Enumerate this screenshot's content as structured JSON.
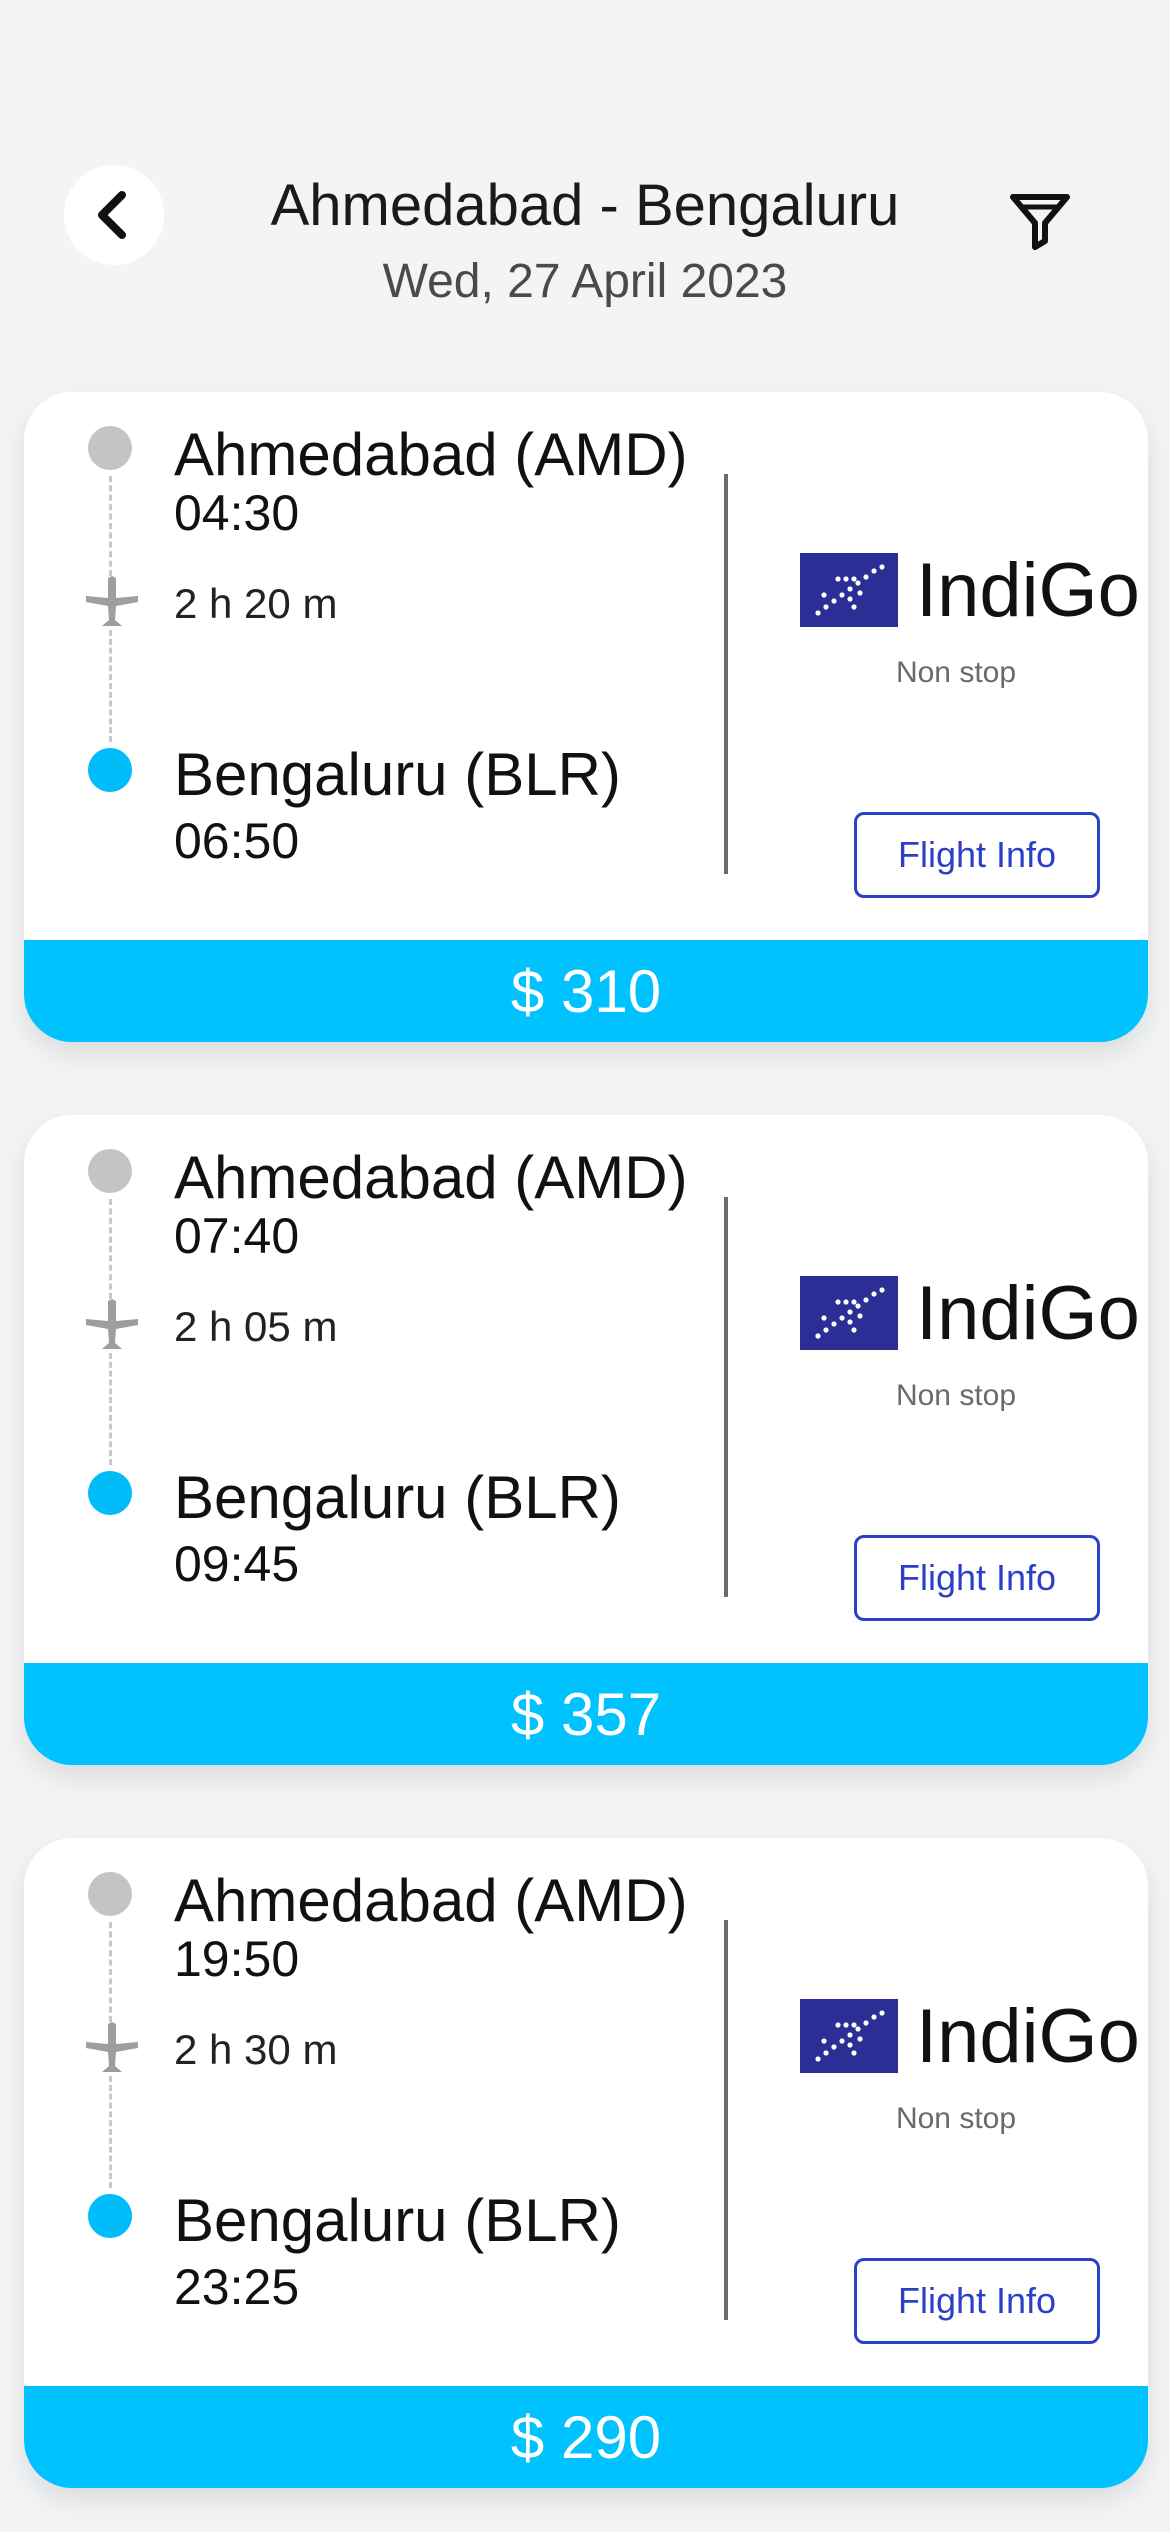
{
  "header": {
    "title": "Ahmedabad - Bengaluru",
    "subtitle": "Wed, 27 April 2023",
    "back_icon": "chevron-left-icon",
    "filter_icon": "filter-icon"
  },
  "colors": {
    "accent": "#00c2ff",
    "destination_dot": "#00bcf8",
    "origin_dot": "#c4c4c4",
    "info_button": "#2c3fc7",
    "airline_logo_bg": "#2b2f95"
  },
  "flights": [
    {
      "origin": "Ahmedabad (AMD)",
      "depart_time": "04:30",
      "duration": "2 h 20 m",
      "destination": "Bengaluru (BLR)",
      "arrive_time": "06:50",
      "airline": "IndiGo",
      "stops": "Non stop",
      "info_label": "Flight Info",
      "price": "$ 310"
    },
    {
      "origin": "Ahmedabad (AMD)",
      "depart_time": "07:40",
      "duration": "2 h 05 m",
      "destination": "Bengaluru (BLR)",
      "arrive_time": "09:45",
      "airline": "IndiGo",
      "stops": "Non stop",
      "info_label": "Flight Info",
      "price": "$ 357"
    },
    {
      "origin": "Ahmedabad (AMD)",
      "depart_time": "19:50",
      "duration": "2 h 30 m",
      "destination": "Bengaluru (BLR)",
      "arrive_time": "23:25",
      "airline": "IndiGo",
      "stops": "Non stop",
      "info_label": "Flight Info",
      "price": "$ 290"
    }
  ]
}
